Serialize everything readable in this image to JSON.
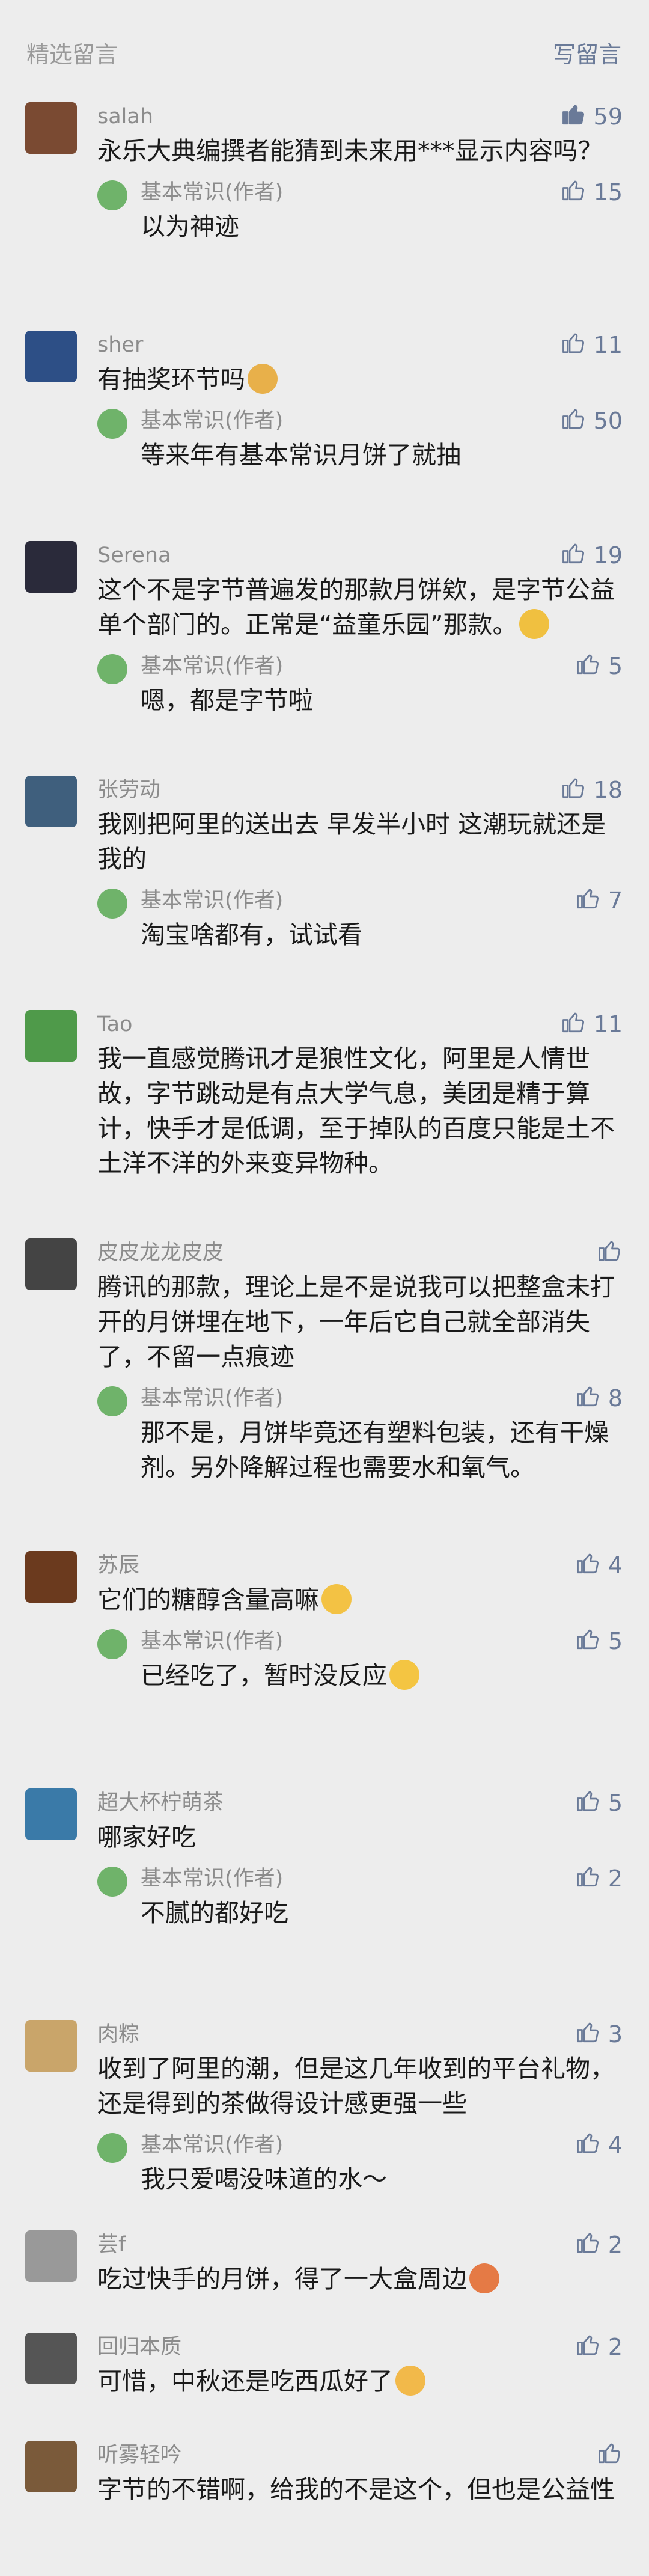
{
  "header": {
    "title": "精选留言",
    "write_label": "写留言"
  },
  "colors": {
    "background": "#ededed",
    "link": "#6a7a98",
    "meta": "#8c8c8c",
    "reply_avatar": "#6fb36a"
  },
  "comments": [
    {
      "name": "salah",
      "likes": "59",
      "liked": true,
      "text": "永乐大典编撰者能猜到未来用***显示内容吗？",
      "reply": {
        "name": "基本常识(作者)",
        "likes": "15",
        "text": "以为神迹"
      }
    },
    {
      "name": "sher",
      "likes": "11",
      "text": "有抽奖环节吗",
      "reply": {
        "name": "基本常识(作者)",
        "likes": "50",
        "text": "等来年有基本常识月饼了就抽"
      }
    },
    {
      "name": "Serena",
      "likes": "19",
      "text": "这个不是字节普遍发的那款月饼欸，是字节公益单个部门的。正常是“益童乐园”那款。",
      "reply": {
        "name": "基本常识(作者)",
        "likes": "5",
        "text": "嗯，都是字节啦"
      }
    },
    {
      "name": "张劳动",
      "likes": "18",
      "text": "我刚把阿里的送出去 早发半小时 这潮玩就还是我的",
      "reply": {
        "name": "基本常识(作者)",
        "likes": "7",
        "text": "淘宝啥都有，试试看"
      }
    },
    {
      "name": "Tao",
      "likes": "11",
      "text": "我一直感觉腾讯才是狼性文化，阿里是人情世故，字节跳动是有点大学气息，美团是精于算计，快手才是低调，至于掉队的百度只能是土不土洋不洋的外来变异物种。"
    },
    {
      "name": "皮皮龙龙皮皮",
      "likes": "",
      "text": "腾讯的那款，理论上是不是说我可以把整盒未打开的月饼埋在地下，一年后它自己就全部消失了，不留一点痕迹",
      "reply": {
        "name": "基本常识(作者)",
        "likes": "8",
        "text": "那不是，月饼毕竟还有塑料包装，还有干燥剂。另外降解过程也需要水和氧气。"
      }
    },
    {
      "name": "苏辰",
      "likes": "4",
      "text": "它们的糖醇含量高嘛",
      "reply": {
        "name": "基本常识(作者)",
        "likes": "5",
        "text": "已经吃了，暂时没反应"
      }
    },
    {
      "name": "超大杯柠萌茶",
      "likes": "5",
      "text": "哪家好吃",
      "reply": {
        "name": "基本常识(作者)",
        "likes": "2",
        "text": "不腻的都好吃"
      }
    },
    {
      "name": "肉粽",
      "likes": "3",
      "text": "收到了阿里的潮，但是这几年收到的平台礼物，还是得到的茶做得设计感更强一些",
      "reply": {
        "name": "基本常识(作者)",
        "likes": "4",
        "text": "我只爱喝没味道的水～"
      }
    },
    {
      "name": "芸f",
      "likes": "2",
      "text": "吃过快手的月饼，得了一大盒周边"
    },
    {
      "name": "回归本质",
      "likes": "2",
      "text": "可惜，中秋还是吃西瓜好了"
    },
    {
      "name": "听雾轻吟",
      "likes": "",
      "text": "字节的不错啊，给我的不是这个，但也是公益性"
    }
  ]
}
